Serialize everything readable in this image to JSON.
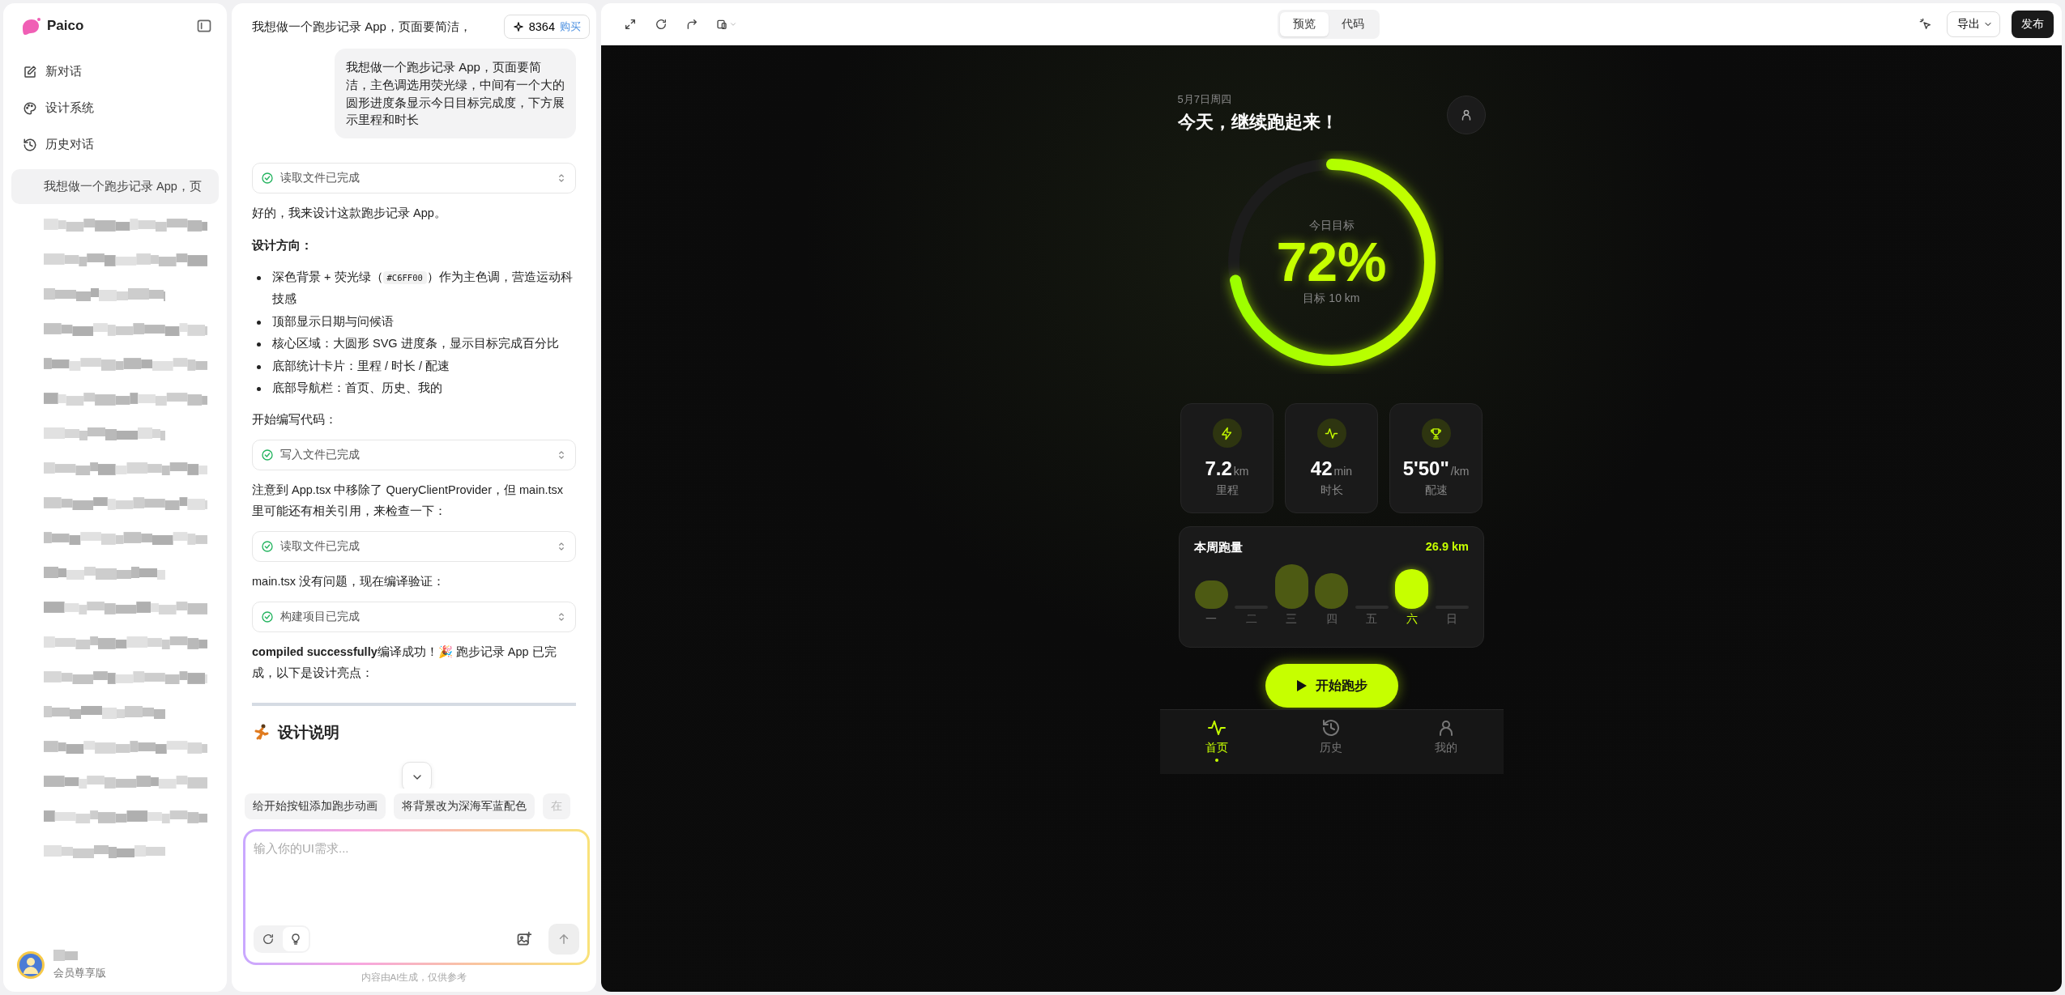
{
  "sidebar": {
    "logo": "Paico",
    "nav": [
      {
        "label": "新对话",
        "kind": "edit"
      },
      {
        "label": "设计系统",
        "kind": "palette"
      },
      {
        "label": "历史对话",
        "kind": "history"
      }
    ],
    "history": [
      {
        "title": "我想做一个跑步记录 App，页",
        "selected": true,
        "redacted": false
      },
      {
        "redacted": true,
        "selected": false
      },
      {
        "redacted": true,
        "selected": false
      },
      {
        "redacted": true,
        "selected": false
      },
      {
        "redacted": true,
        "selected": false
      },
      {
        "redacted": true,
        "selected": false
      },
      {
        "redacted": true,
        "selected": false
      },
      {
        "redacted": true,
        "selected": false
      },
      {
        "redacted": true,
        "selected": false
      },
      {
        "redacted": true,
        "selected": false
      },
      {
        "redacted": true,
        "selected": false
      },
      {
        "redacted": true,
        "selected": false
      },
      {
        "redacted": true,
        "selected": false
      },
      {
        "redacted": true,
        "selected": false
      },
      {
        "redacted": true,
        "selected": false
      },
      {
        "redacted": true,
        "selected": false
      },
      {
        "redacted": true,
        "selected": false
      },
      {
        "redacted": true,
        "selected": false
      },
      {
        "redacted": true,
        "selected": false
      },
      {
        "redacted": true,
        "selected": false
      }
    ],
    "user": {
      "plan": "会员尊享版"
    }
  },
  "chat": {
    "title": "我想做一个跑步记录 App，页面要简洁，",
    "credits": {
      "count": "8364",
      "action": "购买"
    },
    "messages": [
      {
        "kind": "user",
        "text": "我想做一个跑步记录 App，页面要简洁，主色调选用荧光绿，中间有一个大的圆形进度条显示今日目标完成度，下方展示里程和时长"
      },
      {
        "kind": "tool",
        "text": "读取文件已完成"
      },
      {
        "kind": "text",
        "text": "好的，我来设计这款跑步记录 App。"
      },
      {
        "kind": "heading",
        "text": "设计方向："
      },
      {
        "kind": "bullets",
        "items": [
          {
            "text": "深色背景 + 荧光绿（",
            "code": "#C6FF00",
            "after": "）作为主色调，营造运动科技感"
          },
          {
            "text": "顶部显示日期与问候语"
          },
          {
            "text": "核心区域：大圆形 SVG 进度条，显示目标完成百分比"
          },
          {
            "text": "底部统计卡片：里程 / 时长 / 配速"
          },
          {
            "text": "底部导航栏：首页、历史、我的"
          }
        ]
      },
      {
        "kind": "text",
        "text": "开始编写代码："
      },
      {
        "kind": "tool",
        "text": "写入文件已完成"
      },
      {
        "kind": "text",
        "text": "注意到 App.tsx 中移除了 QueryClientProvider，但 main.tsx 里可能还有相关引用，来检查一下："
      },
      {
        "kind": "tool",
        "text": "读取文件已完成"
      },
      {
        "kind": "text",
        "text": "main.tsx 没有问题，现在编译验证："
      },
      {
        "kind": "tool",
        "text": "构建项目已完成"
      },
      {
        "kind": "text",
        "text": "**compiled successfully**编译成功！🎉 跑步记录 App 已完成，以下是设计亮点："
      },
      {
        "kind": "divider"
      },
      {
        "kind": "section",
        "text": "设计说明"
      }
    ],
    "suggestions": [
      "给开始按钮添加跑步动画",
      "将背景改为深海军蓝配色",
      "在"
    ],
    "input": {
      "placeholder": "输入你的UI需求..."
    },
    "footer": "内容由AI生成，仅供参考"
  },
  "preview": {
    "tabs": [
      {
        "label": "预览",
        "selected": true
      },
      {
        "label": "代码",
        "selected": false
      }
    ],
    "export": "导出",
    "publish": "发布",
    "app": {
      "date": "5月7日周四",
      "greeting": "今天，继续跑起来！",
      "goal": {
        "label": "今日目标",
        "percent": "72%",
        "level": 0.72,
        "target": "目标 10 km"
      },
      "stats": [
        {
          "kind": "bolt",
          "value": "7.2",
          "unit": "km",
          "label": "里程"
        },
        {
          "kind": "pulse",
          "value": "42",
          "unit": "min",
          "label": "时长"
        },
        {
          "kind": "trophy",
          "value": "5'50\"",
          "unit": "/km",
          "label": "配速"
        }
      ],
      "weekly": {
        "title": "本周跑量",
        "total": "26.9 km",
        "days": [
          {
            "label": "一",
            "selected": false
          },
          {
            "label": "二",
            "selected": false
          },
          {
            "label": "三",
            "selected": false
          },
          {
            "label": "四",
            "selected": false
          },
          {
            "label": "五",
            "selected": false
          },
          {
            "label": "六",
            "selected": true
          },
          {
            "label": "日",
            "selected": false
          }
        ]
      },
      "start_button": "开始跑步",
      "nav": [
        {
          "label": "首页",
          "kind": "pulse",
          "selected": true
        },
        {
          "label": "历史",
          "kind": "history",
          "selected": false
        },
        {
          "label": "我的",
          "kind": "user",
          "selected": false
        }
      ]
    }
  }
}
